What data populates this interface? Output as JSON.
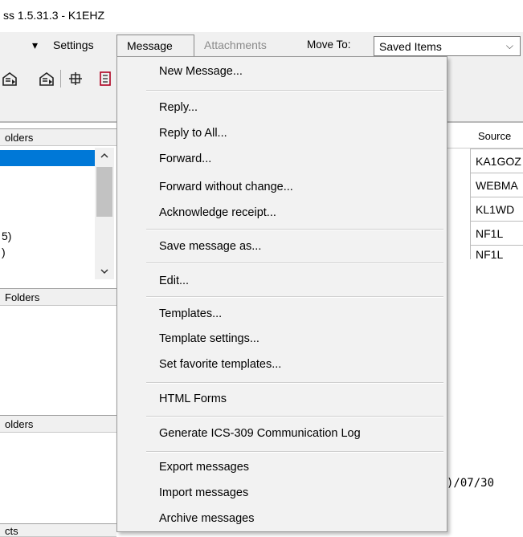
{
  "window": {
    "title": "ss 1.5.31.3 - K1EHZ"
  },
  "menubar": {
    "arrow": "▾",
    "settings": "Settings",
    "message": "Message",
    "attachments": "Attachments",
    "move_to": "Move To:",
    "move_to_value": "Saved Items",
    "dropdown_arrow": "⌵"
  },
  "toolbar": {
    "icons": [
      "open-mail-icon",
      "open-mail-icon",
      "move-icon",
      "book-icon"
    ]
  },
  "folders": {
    "pane1_header": "olders",
    "row_a": "5)",
    "row_b": ")",
    "pane2_header": "Folders",
    "pane3_header": "olders",
    "pane4_header": "cts"
  },
  "grid": {
    "header": "Source",
    "rows": [
      "KA1GOZ",
      "WEBMA",
      "KL1WD",
      "NF1L",
      "NF1L"
    ]
  },
  "background_text": {
    "date_fragment": ")/07/30",
    "bottom_fragment": ""
  },
  "message_menu": {
    "items": [
      "New Message...",
      "Reply...",
      "Reply to All...",
      "Forward...",
      "Forward without change...",
      "Acknowledge receipt...",
      "Save message as...",
      "Edit...",
      "Templates...",
      "Template settings...",
      "Set favorite templates...",
      "HTML Forms",
      "Generate ICS-309 Communication Log",
      "Export messages",
      "Import messages",
      "Archive messages"
    ]
  }
}
